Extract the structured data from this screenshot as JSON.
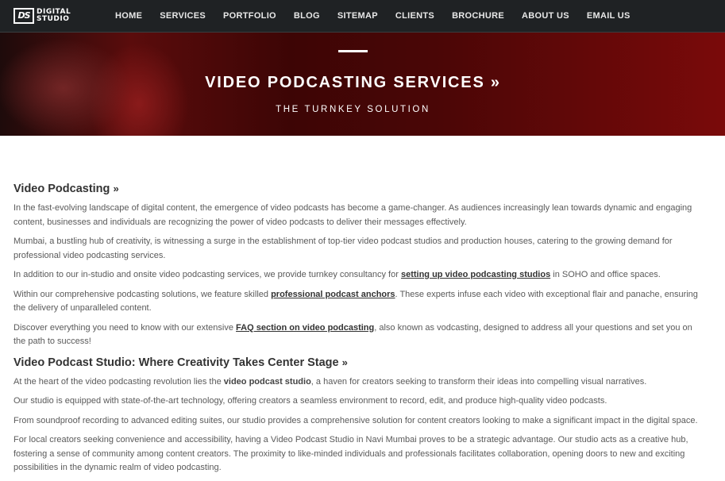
{
  "nav": {
    "logo_mark": "DS",
    "logo_line1": "DIGITAL",
    "logo_line2": "STUDIO",
    "items": [
      "HOME",
      "SERVICES",
      "PORTFOLIO",
      "BLOG",
      "SITEMAP",
      "CLIENTS",
      "BROCHURE",
      "ABOUT US",
      "EMAIL US"
    ]
  },
  "hero": {
    "title": "VIDEO PODCASTING SERVICES »",
    "subtitle": "THE TURNKEY SOLUTION"
  },
  "section1": {
    "heading": "Video Podcasting",
    "heading_suffix": "»",
    "p1": "In the fast-evolving landscape of digital content, the emergence of video podcasts has become a game-changer. As audiences increasingly lean towards dynamic and engaging content, businesses and individuals are recognizing the power of video podcasts to deliver their messages effectively.",
    "p2": "Mumbai, a bustling hub of creativity, is witnessing a surge in the establishment of top-tier video podcast studios and production houses, catering to the growing demand for professional video podcasting services.",
    "p3_before": "In addition to our in-studio and onsite video podcasting services, we provide turnkey consultancy for ",
    "p3_link": "setting up video podcasting studios",
    "p3_after": " in SOHO and office spaces.",
    "p4_before": "Within our comprehensive podcasting solutions, we feature skilled ",
    "p4_link": "professional podcast anchors",
    "p4_after": ". These experts infuse each video with exceptional flair and panache, ensuring the delivery of unparalleled content.",
    "p5_before": "Discover everything you need to know with our extensive ",
    "p5_link": "FAQ section on video podcasting",
    "p5_after": ", also known as vodcasting, designed to address all your questions and set you on the path to success!"
  },
  "section2": {
    "heading": "Video Podcast Studio: Where Creativity Takes Center Stage",
    "heading_suffix": "»",
    "p1_before": "At the heart of the video podcasting revolution lies the ",
    "p1_bold": "video podcast studio",
    "p1_after": ", a haven for creators seeking to transform their ideas into compelling visual narratives.",
    "p2": "Our studio is equipped with state-of-the-art technology, offering creators a seamless environment to record, edit, and produce high-quality video podcasts.",
    "p3": "From soundproof recording to advanced editing suites, our studio provides a comprehensive solution for content creators looking to make a significant impact in the digital space.",
    "p4": "For local creators seeking convenience and accessibility, having a Video Podcast Studio in Navi Mumbai proves to be a strategic advantage. Our studio acts as a creative hub, fostering a sense of community among content creators. The proximity to like-minded individuals and professionals facilitates collaboration, opening doors to new and exciting possibilities in the dynamic realm of video podcasting."
  }
}
